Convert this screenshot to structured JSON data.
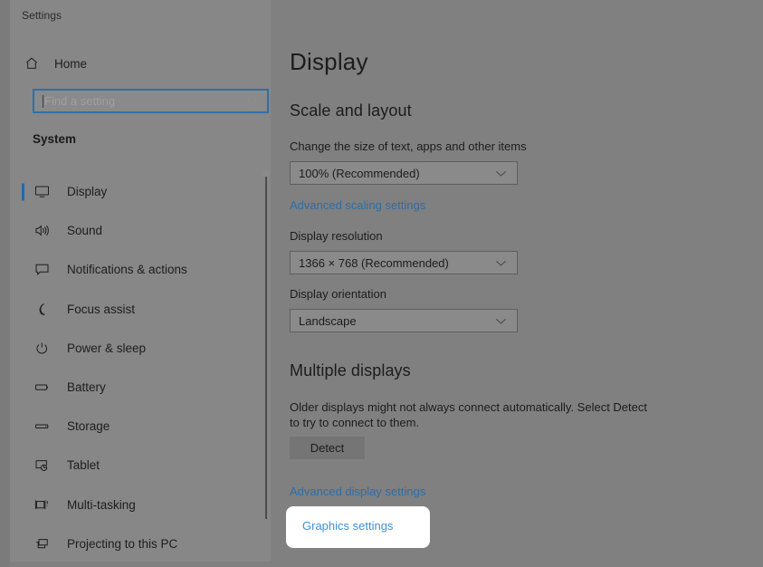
{
  "window": {
    "app_title": "Settings",
    "background_color": "#808080",
    "sidebar_color": "#878787",
    "accent_color": "#1f6cb0",
    "link_color": "#2e6da4"
  },
  "sidebar": {
    "home": {
      "label": "Home",
      "icon": "home-icon"
    },
    "search": {
      "placeholder": "Find a setting",
      "value": "",
      "icon": "search-icon",
      "focused": true
    },
    "group_heading": "System",
    "items": [
      {
        "label": "Display",
        "icon": "monitor-icon",
        "selected": true
      },
      {
        "label": "Sound",
        "icon": "speaker-icon",
        "selected": false
      },
      {
        "label": "Notifications & actions",
        "icon": "notification-icon",
        "selected": false
      },
      {
        "label": "Focus assist",
        "icon": "moon-icon",
        "selected": false
      },
      {
        "label": "Power & sleep",
        "icon": "power-icon",
        "selected": false
      },
      {
        "label": "Battery",
        "icon": "battery-icon",
        "selected": false
      },
      {
        "label": "Storage",
        "icon": "storage-icon",
        "selected": false
      },
      {
        "label": "Tablet",
        "icon": "tablet-icon",
        "selected": false
      },
      {
        "label": "Multi-tasking",
        "icon": "multitasking-icon",
        "selected": false
      },
      {
        "label": "Projecting to this PC",
        "icon": "projecting-icon",
        "selected": false
      }
    ]
  },
  "main": {
    "page_title": "Display",
    "scale_and_layout": {
      "heading": "Scale and layout",
      "scale_label": "Change the size of text, apps and other items",
      "scale_value": "100% (Recommended)",
      "advanced_scaling_link": "Advanced scaling settings",
      "resolution_label": "Display resolution",
      "resolution_value": "1366 × 768 (Recommended)",
      "orientation_label": "Display orientation",
      "orientation_value": "Landscape"
    },
    "multiple_displays": {
      "heading": "Multiple displays",
      "description": "Older displays might not always connect automatically. Select Detect to try to connect to them.",
      "detect_button": "Detect",
      "advanced_display_link": "Advanced display settings"
    },
    "highlight": {
      "link_label": "Graphics settings",
      "link_color": "#3e8ede",
      "callout_background": "#ffffff"
    }
  }
}
